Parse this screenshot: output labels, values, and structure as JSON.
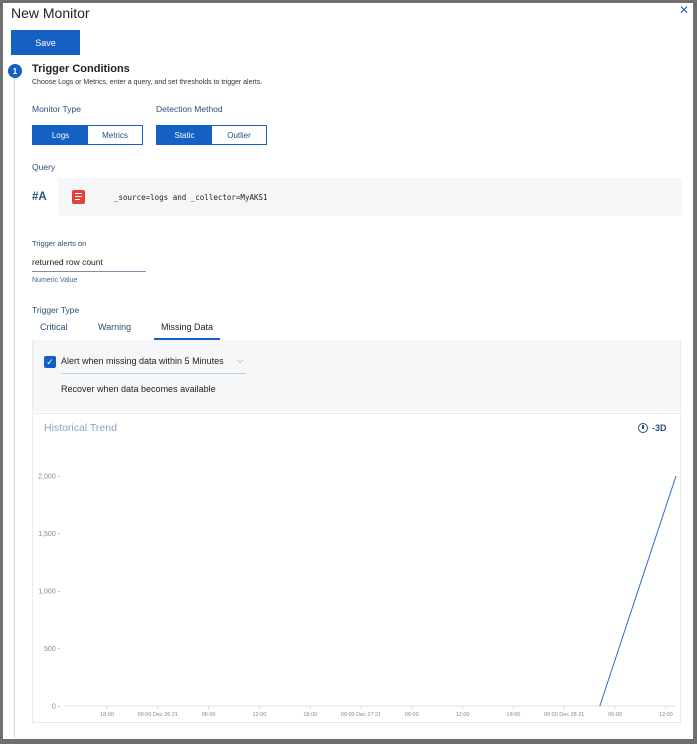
{
  "window": {
    "title": "New Monitor",
    "close_glyph": "✕"
  },
  "toolbar": {
    "save_label": "Save"
  },
  "step": {
    "number": "1",
    "title": "Trigger Conditions",
    "description": "Choose Logs or Metrics, enter a query, and set thresholds to trigger alerts."
  },
  "monitor_type": {
    "label": "Monitor Type",
    "options": [
      "Logs",
      "Metrics"
    ],
    "selected": "Logs"
  },
  "detection_method": {
    "label": "Detection Method",
    "options": [
      "Static",
      "Outlier"
    ],
    "selected": "Static"
  },
  "query": {
    "label": "Query",
    "id": "#A",
    "icon": "log-search-icon",
    "text": "_source=logs and _collector=MyAKS1"
  },
  "trigger_on": {
    "label": "Trigger alerts on",
    "value": "returned row count",
    "hint": "Numeric Value"
  },
  "trigger_type": {
    "label": "Trigger Type",
    "tabs": [
      "Critical",
      "Warning",
      "Missing Data"
    ],
    "selected": "Missing Data"
  },
  "missing_data": {
    "alert_checked": true,
    "alert_text": "Alert when missing data within 5 Minutes",
    "recover_text": "Recover when data becomes available"
  },
  "chart_header": {
    "title": "Historical Trend",
    "range_label": "-3D",
    "range_icon": "clock-icon"
  },
  "colors": {
    "accent": "#1560c3",
    "line": "#2f6fc4"
  },
  "chart_data": {
    "type": "line",
    "title": "Historical Trend",
    "y_ticks": [
      "0",
      "500",
      "1,000",
      "1,500",
      "2,000"
    ],
    "ylim": [
      0,
      2000
    ],
    "x_ticks": [
      "18:00",
      "00:00 Dec 26 21",
      "06:00",
      "12:00",
      "18:00",
      "00:00 Dec 27 21",
      "06:00",
      "12:00",
      "18:00",
      "00:00 Dec 28 21",
      "06:00",
      "12:00"
    ],
    "series": [
      {
        "x": [
          9.7,
          11.2
        ],
        "values": [
          0,
          2000
        ]
      }
    ],
    "grid": false
  }
}
